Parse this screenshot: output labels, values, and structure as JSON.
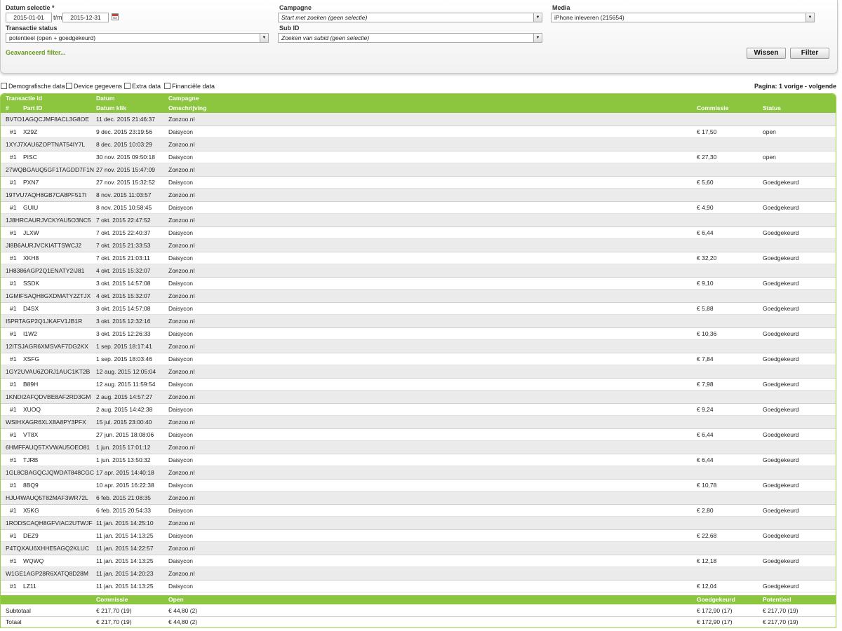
{
  "filters": {
    "date_label": "Datum selectie *",
    "date_from": "2015-01-01",
    "date_sep": "t/m",
    "date_to": "2015-12-31",
    "status_label": "Transactie status",
    "status_value": "potentieel (open + goedgekeurd)",
    "campaign_label": "Campagne",
    "campaign_placeholder": "Start met zoeken (geen selectie)",
    "subid_label": "Sub ID",
    "subid_placeholder": "Zoeken van subid (geen selectie)",
    "media_label": "Media",
    "media_value": "iPhone inleveren (215654)",
    "advanced_link": "Geavanceerd filter...",
    "clear_button": "Wissen",
    "filter_button": "Filter"
  },
  "options": {
    "demografisch": "Demografische data",
    "device": "Device gegevens",
    "extra": "Extra data",
    "financieel": "Financiële data"
  },
  "pagination": "Pagina: 1 vorige - volgende",
  "table": {
    "headers": {
      "transaction_id": "Transactie id",
      "datum": "Datum",
      "campagne": "Campagne",
      "hash": "#",
      "part_id": "Part ID",
      "datum_klik": "Datum klik",
      "omschrijving": "Omschrijving",
      "commissie": "Commissie",
      "status": "Status"
    },
    "rows": [
      {
        "id": "BVTO1AGQCJMF8ACL3G8OE",
        "datum": "11 dec. 2015 21:46:37",
        "campagne": "Zonzoo.nl",
        "num": "#1",
        "part": "X29Z",
        "klik": "9 dec. 2015 23:19:56",
        "omschrijving": "Daisycon",
        "commissie": "€ 17,50",
        "status": "open"
      },
      {
        "id": "1XYJ7XAU6ZOPTNAT54IY7L",
        "datum": "8 dec. 2015 10:03:29",
        "campagne": "Zonzoo.nl",
        "num": "#1",
        "part": "PISC",
        "klik": "30 nov. 2015 09:50:18",
        "omschrijving": "Daisycon",
        "commissie": "€ 27,30",
        "status": "open"
      },
      {
        "id": "27WQBGAUQ5GF1TAGDD7F1N",
        "datum": "27 nov. 2015 15:47:09",
        "campagne": "Zonzoo.nl",
        "num": "#1",
        "part": "PXN7",
        "klik": "27 nov. 2015 15:32:52",
        "omschrijving": "Daisycon",
        "commissie": "€ 5,60",
        "status": "Goedgekeurd"
      },
      {
        "id": "19TVU7AQH8GB7CA8PF517I",
        "datum": "8 nov. 2015 11:03:57",
        "campagne": "Zonzoo.nl",
        "num": "#1",
        "part": "GUIU",
        "klik": "8 nov. 2015 10:58:45",
        "omschrijving": "Daisycon",
        "commissie": "€ 4,90",
        "status": "Goedgekeurd"
      },
      {
        "id": "1J8HRCAURJVCKYAU5O3NC5",
        "datum": "7 okt. 2015 22:47:52",
        "campagne": "Zonzoo.nl",
        "num": "#1",
        "part": "JLXW",
        "klik": "7 okt. 2015 22:40:37",
        "omschrijving": "Daisycon",
        "commissie": "€ 6,44",
        "status": "Goedgekeurd"
      },
      {
        "id": "JI8B6AURJVCKIATTSWCJ2",
        "datum": "7 okt. 2015 21:33:53",
        "campagne": "Zonzoo.nl",
        "num": "#1",
        "part": "XKH8",
        "klik": "7 okt. 2015 21:03:11",
        "omschrijving": "Daisycon",
        "commissie": "€ 32,20",
        "status": "Goedgekeurd"
      },
      {
        "id": "1H8386AGP2Q1ENATY2IJ81",
        "datum": "4 okt. 2015 15:32:07",
        "campagne": "Zonzoo.nl",
        "num": "#1",
        "part": "SSDK",
        "klik": "3 okt. 2015 14:57:08",
        "omschrijving": "Daisycon",
        "commissie": "€ 9,10",
        "status": "Goedgekeurd"
      },
      {
        "id": "1GMIFSAQH8GXDMATY2ZTJX",
        "datum": "4 okt. 2015 15:32:07",
        "campagne": "Zonzoo.nl",
        "num": "#1",
        "part": "D4SX",
        "klik": "3 okt. 2015 14:57:08",
        "omschrijving": "Daisycon",
        "commissie": "€ 5,88",
        "status": "Goedgekeurd"
      },
      {
        "id": "I5PRTAGP2Q1JKAFV1JB1R",
        "datum": "3 okt. 2015 12:32:16",
        "campagne": "Zonzoo.nl",
        "num": "#1",
        "part": "I1W2",
        "klik": "3 okt. 2015 12:26:33",
        "omschrijving": "Daisycon",
        "commissie": "€ 10,36",
        "status": "Goedgekeurd"
      },
      {
        "id": "12ITSJAGR6XMSVAF7DG2KX",
        "datum": "1 sep. 2015 18:17:41",
        "campagne": "Zonzoo.nl",
        "num": "#1",
        "part": "XSFG",
        "klik": "1 sep. 2015 18:03:46",
        "omschrijving": "Daisycon",
        "commissie": "€ 7,84",
        "status": "Goedgekeurd"
      },
      {
        "id": "1GY2UVAU6ZORJ1AUC1KT2B",
        "datum": "12 aug. 2015 12:05:04",
        "campagne": "Zonzoo.nl",
        "num": "#1",
        "part": "B89H",
        "klik": "12 aug. 2015 11:59:54",
        "omschrijving": "Daisycon",
        "commissie": "€ 7,98",
        "status": "Goedgekeurd"
      },
      {
        "id": "1KNDI2AFQDVBE8AF2RD3GM",
        "datum": "2 aug. 2015 14:57:27",
        "campagne": "Zonzoo.nl",
        "num": "#1",
        "part": "XUOQ",
        "klik": "2 aug. 2015 14:42:38",
        "omschrijving": "Daisycon",
        "commissie": "€ 9,24",
        "status": "Goedgekeurd"
      },
      {
        "id": "WSIHXAGR6XLX8A8PY3PFX",
        "datum": "15 jul. 2015 23:00:40",
        "campagne": "Zonzoo.nl",
        "num": "#1",
        "part": "VT8X",
        "klik": "27 jun. 2015 18:08:06",
        "omschrijving": "Daisycon",
        "commissie": "€ 6,44",
        "status": "Goedgekeurd"
      },
      {
        "id": "6HMFFAUQ5TXVWAU5OEO81",
        "datum": "1 jun. 2015 17:01:12",
        "campagne": "Zonzoo.nl",
        "num": "#1",
        "part": "TJRB",
        "klik": "1 jun. 2015 13:50:32",
        "omschrijving": "Daisycon",
        "commissie": "€ 6,44",
        "status": "Goedgekeurd"
      },
      {
        "id": "1GL8CBAGQCJQWDAT848CGC",
        "datum": "17 apr. 2015 14:40:18",
        "campagne": "Zonzoo.nl",
        "num": "#1",
        "part": "8BQ9",
        "klik": "10 apr. 2015 16:22:38",
        "omschrijving": "Daisycon",
        "commissie": "€ 10,78",
        "status": "Goedgekeurd"
      },
      {
        "id": "HJU4WAUQ5T82MAF3WR72L",
        "datum": "6 feb. 2015 21:08:35",
        "campagne": "Zonzoo.nl",
        "num": "#1",
        "part": "X5KG",
        "klik": "6 feb. 2015 20:54:33",
        "omschrijving": "Daisycon",
        "commissie": "€ 2,80",
        "status": "Goedgekeurd"
      },
      {
        "id": "1RODSCAQH8GFVIAC2UTWJF",
        "datum": "11 jan. 2015 14:25:10",
        "campagne": "Zonzoo.nl",
        "num": "#1",
        "part": "DEZ9",
        "klik": "11 jan. 2015 14:13:25",
        "omschrijving": "Daisycon",
        "commissie": "€ 22,68",
        "status": "Goedgekeurd"
      },
      {
        "id": "P4TQXAU6XHHE5AGQ2KLUC",
        "datum": "11 jan. 2015 14:22:57",
        "campagne": "Zonzoo.nl",
        "num": "#1",
        "part": "WQWQ",
        "klik": "11 jan. 2015 14:13:25",
        "omschrijving": "Daisycon",
        "commissie": "€ 12,18",
        "status": "Goedgekeurd"
      },
      {
        "id": "W1GE1AGP28R6XATQ8D28M",
        "datum": "11 jan. 2015 14:20:23",
        "campagne": "Zonzoo.nl",
        "num": "#1",
        "part": "LZ11",
        "klik": "11 jan. 2015 14:13:25",
        "omschrijving": "Daisycon",
        "commissie": "€ 12,04",
        "status": "Goedgekeurd"
      }
    ],
    "summary_headers": {
      "commissie": "Commissie",
      "open": "Open",
      "goedgekeurd": "Goedgekeurd",
      "potentieel": "Potentieel"
    },
    "subtotal": {
      "label": "Subtotaal",
      "commissie": "€ 217,70 (19)",
      "open": "€ 44,80 (2)",
      "goedgekeurd": "€ 172,90 (17)",
      "potentieel": "€ 217,70 (19)"
    },
    "total": {
      "label": "Totaal",
      "commissie": "€ 217,70 (19)",
      "open": "€ 44,80 (2)",
      "goedgekeurd": "€ 172,90 (17)",
      "potentieel": "€ 217,70 (19)"
    }
  },
  "colors": {
    "accent": "#8cc63f",
    "link": "#6a9b1d"
  },
  "icons": {
    "calendar": "calendar-icon",
    "dropdown": "chevron-down-icon"
  }
}
